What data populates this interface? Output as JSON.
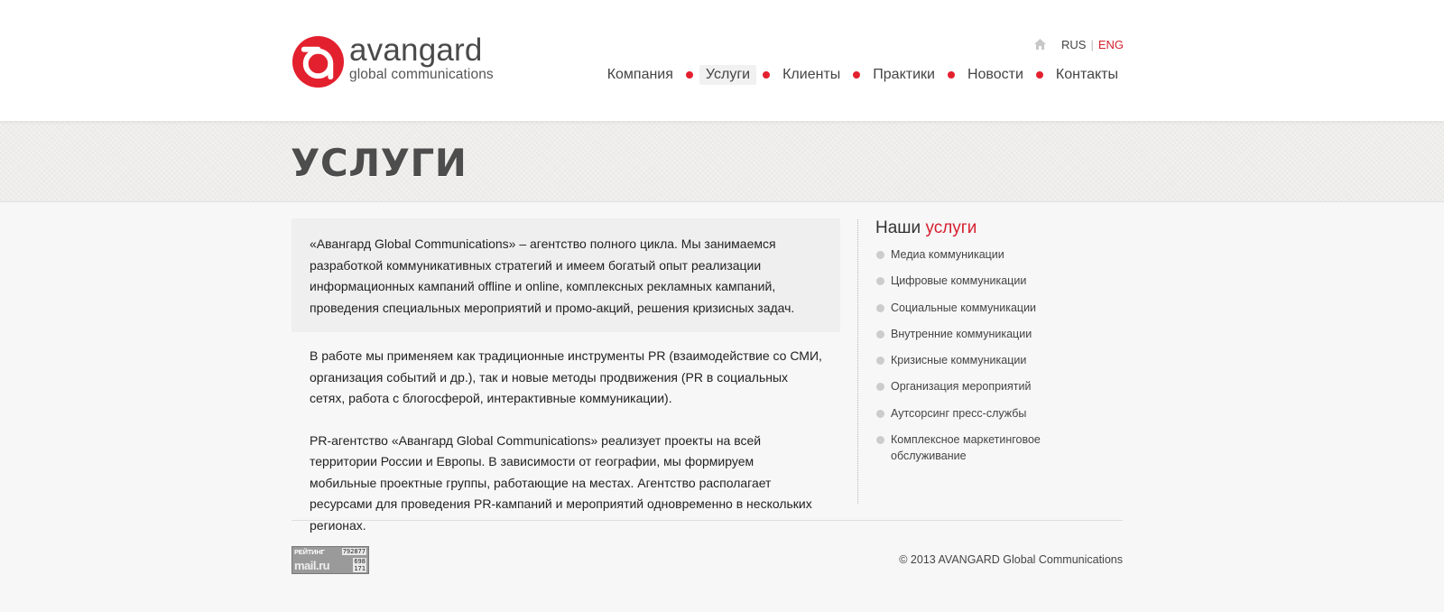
{
  "brand": {
    "name": "avangard",
    "tagline": "global communications",
    "logo_color": "#e3202e"
  },
  "lang": {
    "rus": "RUS",
    "separator": "|",
    "eng": "ENG",
    "active": "ENG"
  },
  "nav": {
    "items": [
      "Компания",
      "Услуги",
      "Клиенты",
      "Практики",
      "Новости",
      "Контакты"
    ],
    "active": "Услуги"
  },
  "page": {
    "title": "УСЛУГИ"
  },
  "content": {
    "lead": "«Авангард Global Communications» – агентство полного цикла. Мы занимаемся разработкой коммуникативных стратегий и имеем богатый опыт реализации информационных кампаний offline и online, комплексных рекламных кампаний, проведения специальных мероприятий и промо-акций, решения кризисных задач.",
    "p1": "В работе мы применяем как традиционные инструменты PR (взаимодействие со СМИ, организация событий и др.), так и новые методы продвижения (PR в социальных сетях, работа с блогосферой, интерактивные коммуникации).",
    "p2": "PR-агентство «Авангард Global Communications» реализует проекты на всей территории России и Европы. В зависимости от географии, мы формируем мобильные проектные группы, работающие на местах. Агентство располагает ресурсами для проведения PR-кампаний и мероприятий одновременно в нескольких регионах."
  },
  "sidebar": {
    "title_plain": "Наши",
    "title_accent": "услуги",
    "services": [
      "Медиа коммуникации",
      "Цифровые коммуникации",
      "Социальные коммуникации",
      "Внутренние коммуникации",
      "Кризисные коммуникации",
      "Организация мероприятий",
      "Аутсорсинг пресс-службы",
      "Комплексное маркетинговое обслуживание"
    ]
  },
  "footer": {
    "rating": {
      "label": "РЕЙТИНГ",
      "brand": "mail.ru",
      "values": [
        "792877",
        "698",
        "171"
      ]
    },
    "copyright": "© 2013 AVANGARD Global Communications"
  },
  "colors": {
    "accent": "#d62030",
    "dot": "#e3202e"
  }
}
